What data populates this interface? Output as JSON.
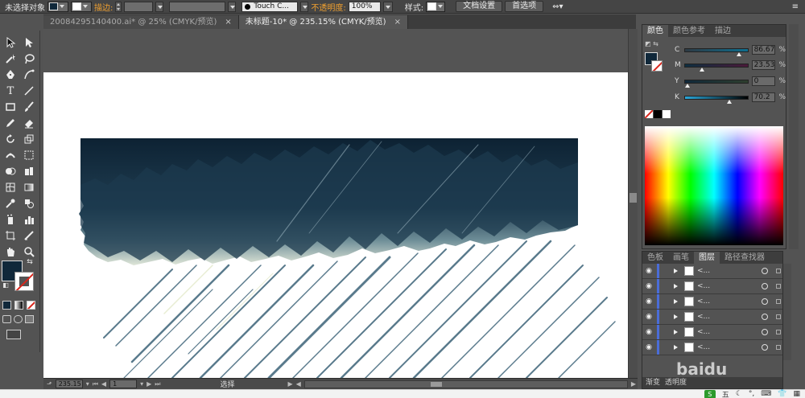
{
  "controlbar": {
    "selection_status": "未选择对象",
    "stroke_label": "描边:",
    "brush_name": "Touch C...",
    "opacity_label": "不透明度:",
    "opacity_value": "100%",
    "style_label": "样式:",
    "doc_setup_button": "文档设置",
    "preferences_button": "首选项"
  },
  "tabs": [
    {
      "label": "20084295140400.ai* @ 25% (CMYK/预览)",
      "close": "×"
    },
    {
      "label": "未标题-10* @ 235.15% (CMYK/预览)",
      "close": "×"
    }
  ],
  "colors": {
    "fill": "#10283a",
    "accent_orange": "#f0a030",
    "layer_color": "#4a6dd8"
  },
  "color_panel": {
    "tabs": [
      "颜色",
      "颜色参考",
      "描边"
    ],
    "sliders": [
      {
        "label": "C",
        "value": "86.67",
        "fraction": 0.87
      },
      {
        "label": "M",
        "value": "23.53",
        "fraction": 0.24
      },
      {
        "label": "Y",
        "value": "0",
        "fraction": 0.0
      },
      {
        "label": "K",
        "value": "70.2",
        "fraction": 0.7
      }
    ],
    "percent": "%"
  },
  "layers_panel": {
    "tabs": [
      "色板",
      "画笔",
      "图层",
      "路径查找器"
    ],
    "row_name": "<...",
    "row_count": 6,
    "bottom_tabs": [
      "渐变",
      "透明度"
    ]
  },
  "statusbar": {
    "zoom": "235.15",
    "page": "1",
    "tool_status": "选择"
  },
  "watermark": "baidu",
  "taskbar": {
    "ime_label": "S",
    "ime_char": "五"
  }
}
